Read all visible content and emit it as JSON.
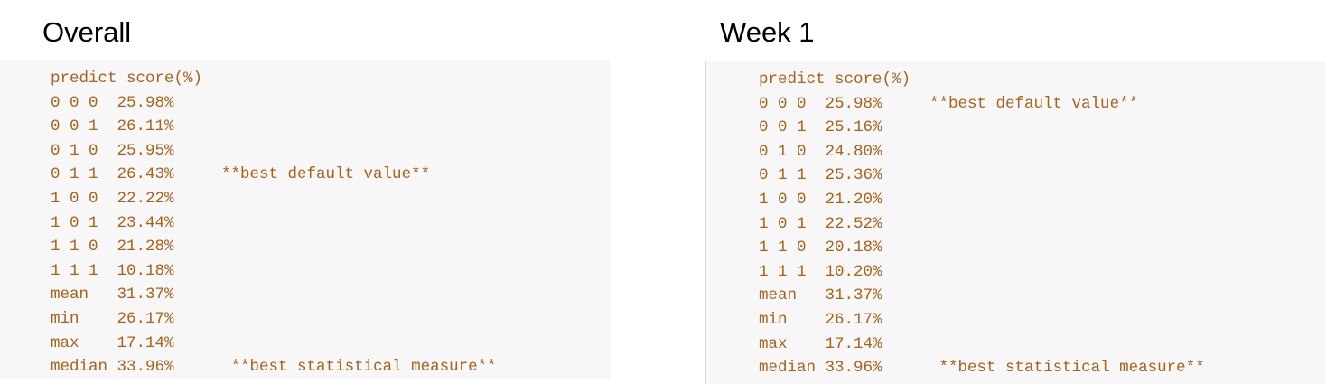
{
  "panels": [
    {
      "title": "Overall",
      "lines": [
        {
          "text": "predict score(%)",
          "note": ""
        },
        {
          "text": "0 0 0  25.98%",
          "note": ""
        },
        {
          "text": "0 0 1  26.11%",
          "note": ""
        },
        {
          "text": "0 1 0  25.95%",
          "note": ""
        },
        {
          "text": "0 1 1  26.43%     ",
          "note": "**best default value**"
        },
        {
          "text": "1 0 0  22.22%",
          "note": ""
        },
        {
          "text": "1 0 1  23.44%",
          "note": ""
        },
        {
          "text": "1 1 0  21.28%",
          "note": ""
        },
        {
          "text": "1 1 1  10.18%",
          "note": ""
        },
        {
          "text": "mean   31.37%",
          "note": ""
        },
        {
          "text": "min    26.17%",
          "note": ""
        },
        {
          "text": "max    17.14%",
          "note": ""
        },
        {
          "text": "median 33.96%      ",
          "note": "**best statistical measure**"
        }
      ]
    },
    {
      "title": "Week 1",
      "lines": [
        {
          "text": "predict score(%)",
          "note": ""
        },
        {
          "text": "0 0 0  25.98%     ",
          "note": "**best default value**"
        },
        {
          "text": "0 0 1  25.16%",
          "note": ""
        },
        {
          "text": "0 1 0  24.80%",
          "note": ""
        },
        {
          "text": "0 1 1  25.36%",
          "note": ""
        },
        {
          "text": "1 0 0  21.20%",
          "note": ""
        },
        {
          "text": "1 0 1  22.52%",
          "note": ""
        },
        {
          "text": "1 1 0  20.18%",
          "note": ""
        },
        {
          "text": "1 1 1  10.20%",
          "note": ""
        },
        {
          "text": "mean   31.37%",
          "note": ""
        },
        {
          "text": "min    26.17%",
          "note": ""
        },
        {
          "text": "max    17.14%",
          "note": ""
        },
        {
          "text": "median 33.96%      ",
          "note": "**best statistical measure**"
        }
      ]
    }
  ]
}
